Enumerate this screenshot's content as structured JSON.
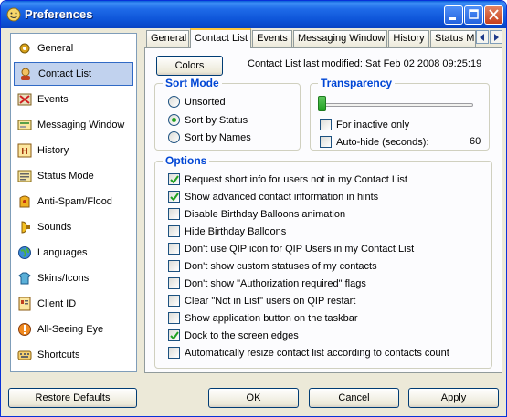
{
  "window": {
    "title": "Preferences"
  },
  "nav": {
    "items": [
      {
        "label": "General",
        "icon": "gear-icon"
      },
      {
        "label": "Contact List",
        "icon": "contact-list-icon",
        "selected": true
      },
      {
        "label": "Events",
        "icon": "events-icon"
      },
      {
        "label": "Messaging Window",
        "icon": "messaging-window-icon"
      },
      {
        "label": "History",
        "icon": "history-icon"
      },
      {
        "label": "Status Mode",
        "icon": "status-mode-icon"
      },
      {
        "label": "Anti-Spam/Flood",
        "icon": "anti-spam-icon"
      },
      {
        "label": "Sounds",
        "icon": "sounds-icon"
      },
      {
        "label": "Languages",
        "icon": "languages-icon"
      },
      {
        "label": "Skins/Icons",
        "icon": "skins-icon"
      },
      {
        "label": "Client ID",
        "icon": "client-id-icon"
      },
      {
        "label": "All-Seeing Eye",
        "icon": "all-seeing-eye-icon"
      },
      {
        "label": "Shortcuts",
        "icon": "shortcuts-icon"
      }
    ]
  },
  "tabs": [
    {
      "label": "General"
    },
    {
      "label": "Contact List",
      "active": true
    },
    {
      "label": "Events"
    },
    {
      "label": "Messaging Window"
    },
    {
      "label": "History"
    },
    {
      "label": "Status M"
    }
  ],
  "contact_list": {
    "colors_button": "Colors",
    "last_modified": "Contact List last modified: Sat Feb 02 2008 09:25:19",
    "sort_mode": {
      "title": "Sort Mode",
      "options": [
        {
          "label": "Unsorted",
          "checked": false
        },
        {
          "label": "Sort by Status",
          "checked": true
        },
        {
          "label": "Sort by Names",
          "checked": false
        }
      ]
    },
    "transparency": {
      "title": "Transparency",
      "level": 0,
      "inactive_only": {
        "label": "For inactive only",
        "checked": false
      },
      "auto_hide": {
        "label": "Auto-hide (seconds):",
        "checked": false,
        "value": "60"
      }
    },
    "options": {
      "title": "Options",
      "items": [
        {
          "label": "Request short info for users not in my Contact List",
          "checked": true
        },
        {
          "label": "Show advanced contact information in hints",
          "checked": true
        },
        {
          "label": "Disable Birthday Balloons animation",
          "checked": false
        },
        {
          "label": "Hide Birthday Balloons",
          "checked": false
        },
        {
          "label": "Don't use QIP icon for QIP Users in my Contact List",
          "checked": false
        },
        {
          "label": "Don't show custom statuses of my contacts",
          "checked": false
        },
        {
          "label": "Don't show \"Authorization required\" flags",
          "checked": false
        },
        {
          "label": "Clear \"Not in List\" users on QIP restart",
          "checked": false
        },
        {
          "label": "Show application button on the taskbar",
          "checked": false
        },
        {
          "label": "Dock to the screen edges",
          "checked": true
        },
        {
          "label": "Automatically resize contact list according to contacts count",
          "checked": false
        }
      ]
    }
  },
  "footer": {
    "restore_defaults": "Restore Defaults",
    "ok": "OK",
    "cancel": "Cancel",
    "apply": "Apply"
  },
  "colors": {
    "title_bar": "#0a5fd8",
    "accent_group_title": "#0046d5",
    "check_green": "#21a121",
    "selection": "#c1d2ee"
  }
}
